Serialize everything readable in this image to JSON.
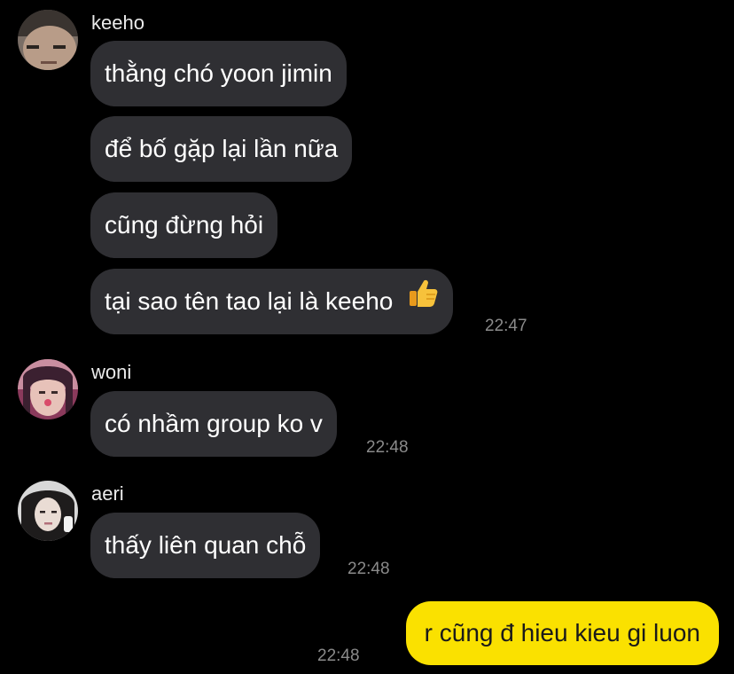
{
  "colors": {
    "background": "#000000",
    "incoming_bubble": "#2f2f33",
    "outgoing_bubble": "#fae100",
    "timestamp": "#8a8a8a"
  },
  "messages": [
    {
      "sender": "keeho",
      "avatar": "avatar-keeho",
      "bubbles": [
        "thằng chó yoon jimin",
        "để bố gặp lại lần nữa",
        "cũng đừng hỏi",
        "tại sao tên tao lại là keeho"
      ],
      "emoji": "thumbs-up-icon",
      "time": "22:47"
    },
    {
      "sender": "woni",
      "avatar": "avatar-woni",
      "bubbles": [
        "có nhầm group ko v"
      ],
      "time": "22:48"
    },
    {
      "sender": "aeri",
      "avatar": "avatar-aeri",
      "bubbles": [
        "thấy liên quan chỗ"
      ],
      "time": "22:48"
    }
  ],
  "outgoing": {
    "text": "r cũng đ hieu kieu gi luon",
    "time": "22:48"
  }
}
